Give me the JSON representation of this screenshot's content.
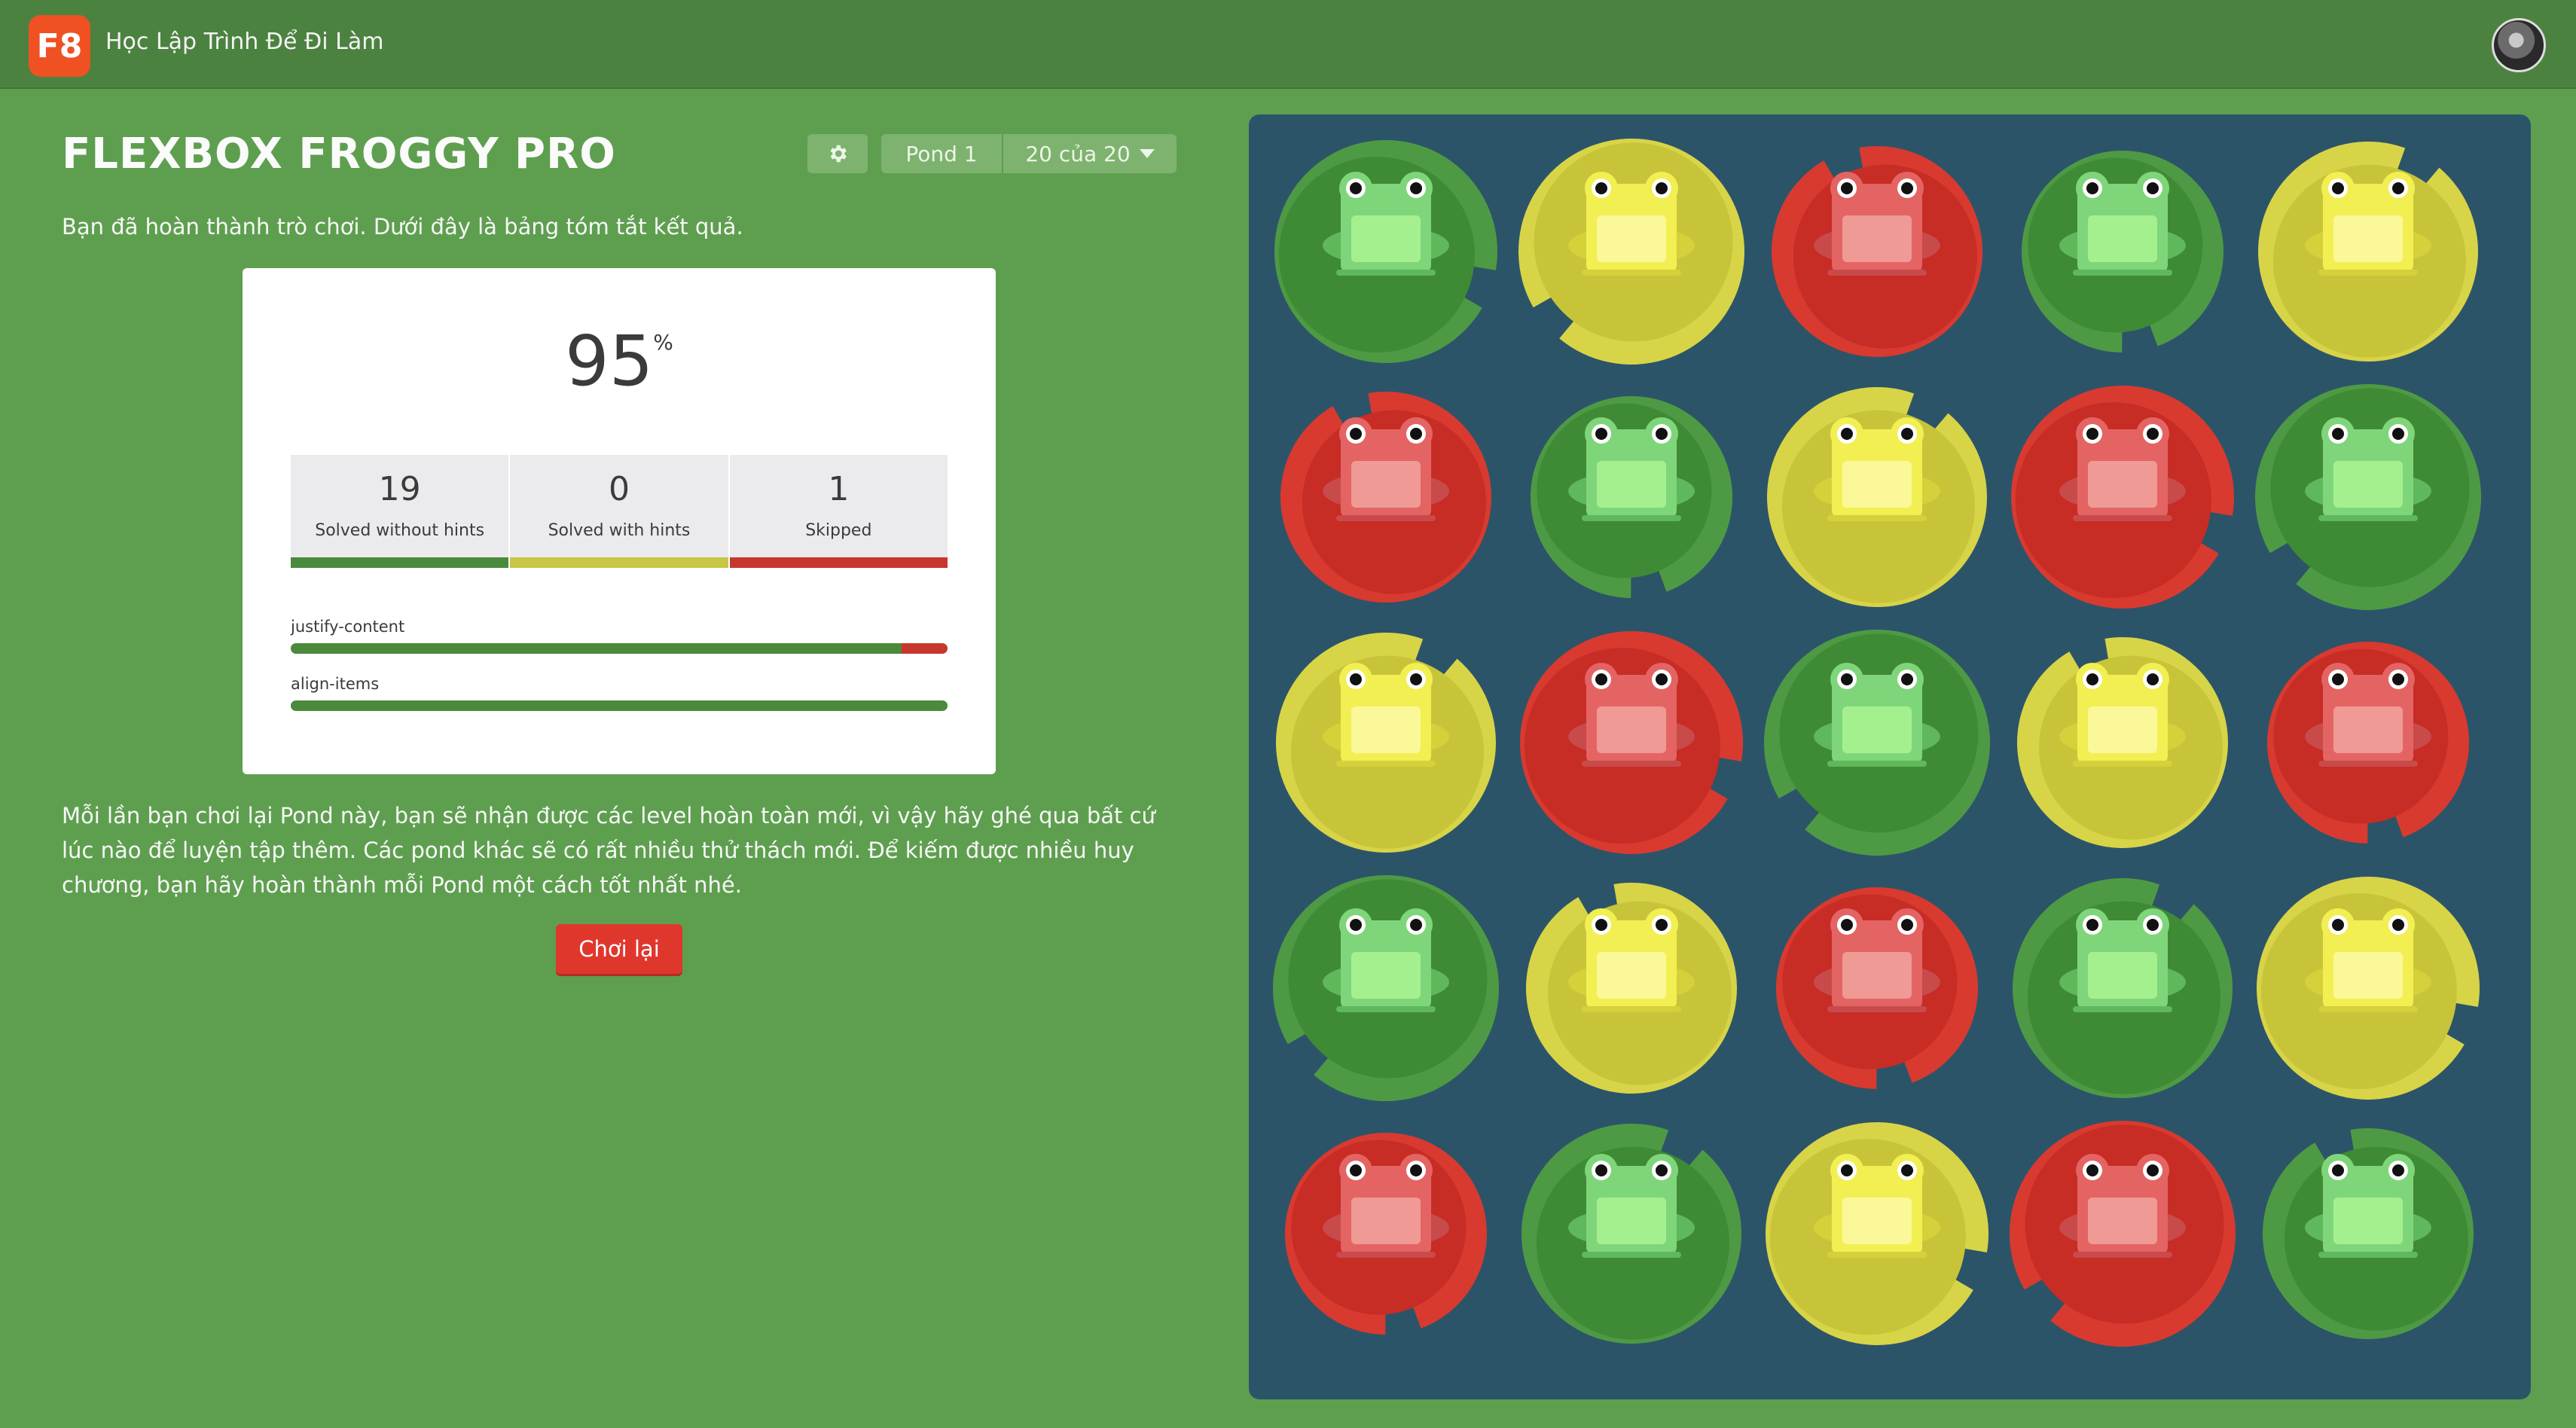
{
  "header": {
    "logo_text": "F8",
    "site_title": "Học Lập Trình Để Đi Làm",
    "avatar": "user-avatar"
  },
  "game": {
    "title": "FLEXBOX FROGGY PRO",
    "settings_icon": "gear-icon",
    "pond_label": "Pond 1",
    "level_label": "20 của 20",
    "intro": "Bạn đã hoàn thành trò chơi. Dưới đây là bảng tóm tắt kết quả.",
    "summary": {
      "score": "95",
      "score_unit": "%",
      "stats": [
        {
          "value": "19",
          "label": "Solved without hints",
          "color": "#4a8a3c"
        },
        {
          "value": "0",
          "label": "Solved with hints",
          "color": "#c8c745"
        },
        {
          "value": "1",
          "label": "Skipped",
          "color": "#c8372d"
        }
      ],
      "properties": [
        {
          "name": "justify-content",
          "solved_fraction": 0.93,
          "skipped_fraction": 0.07
        },
        {
          "name": "align-items",
          "solved_fraction": 1.0,
          "skipped_fraction": 0.0
        }
      ]
    },
    "outro": "Mỗi lần bạn chơi lại Pond này, bạn sẽ nhận được các level hoàn toàn mới, vì vậy hãy ghé qua bất cứ lúc nào để luyện tập thêm. Các pond khác sẽ có rất nhiều thử thách mới. Để kiếm được nhiều huy chương, bạn hãy hoàn thành mỗi Pond một cách tốt nhất nhé.",
    "replay_label": "Chơi lại"
  },
  "colors": {
    "green": {
      "pad": "#3f8a34",
      "pad_light": "#4e9a44",
      "frog": "#7fd67a",
      "frog_dark": "#5fb85c",
      "belly": "#a4f08f"
    },
    "yellow": {
      "pad": "#c8c43a",
      "pad_light": "#d8d448",
      "frog": "#f2ef52",
      "frog_dark": "#d4d13a",
      "belly": "#fbf89a"
    },
    "red": {
      "pad": "#c72c25",
      "pad_light": "#d83a30",
      "frog": "#e46464",
      "frog_dark": "#c94a4a",
      "belly": "#ef9a94"
    }
  },
  "board": {
    "rows": [
      [
        "green",
        "yellow",
        "red",
        "green",
        "yellow"
      ],
      [
        "red",
        "green",
        "yellow",
        "red",
        "green"
      ],
      [
        "yellow",
        "red",
        "green",
        "yellow",
        "red"
      ],
      [
        "green",
        "yellow",
        "red",
        "green",
        "yellow"
      ],
      [
        "red",
        "green",
        "yellow",
        "red",
        "green"
      ]
    ]
  }
}
